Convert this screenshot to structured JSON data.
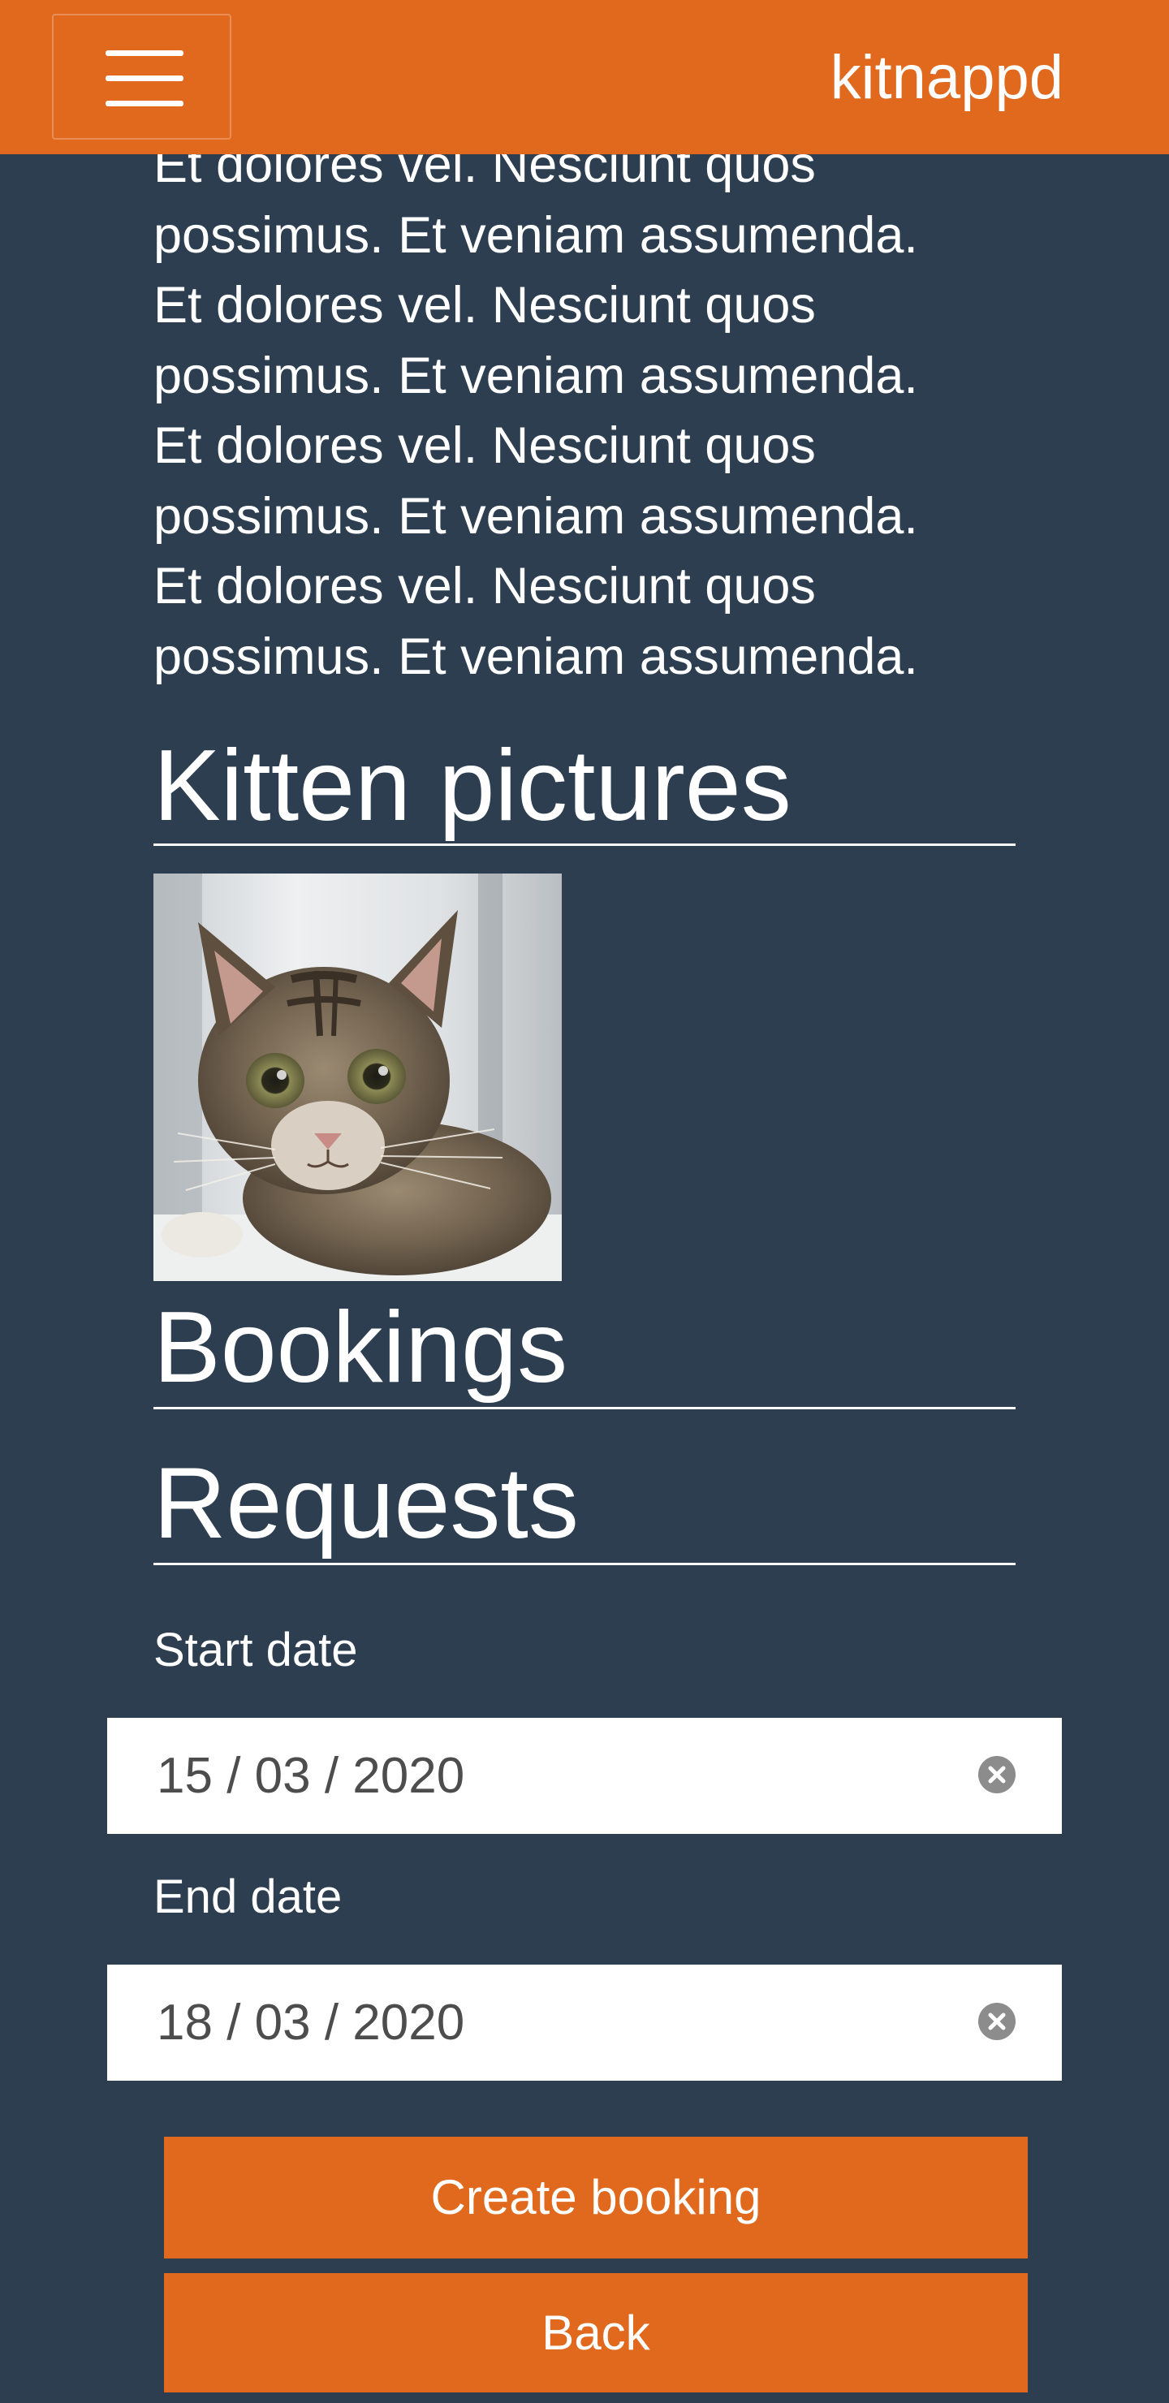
{
  "header": {
    "brand": "kitnappd",
    "menu_icon": "hamburger-menu-icon"
  },
  "intro_lines": [
    "Et dolores vel. Nesciunt quos",
    "possimus. Et veniam assumenda.",
    "Et dolores vel. Nesciunt quos",
    "possimus. Et veniam assumenda.",
    "Et dolores vel. Nesciunt quos",
    "possimus. Et veniam assumenda.",
    "Et dolores vel. Nesciunt quos",
    "possimus. Et veniam assumenda."
  ],
  "sections": {
    "kittens": "Kitten pictures",
    "bookings": "Bookings",
    "requests": "Requests"
  },
  "form": {
    "start_label": "Start date",
    "start_value": "15 / 03 / 2020",
    "end_label": "End date",
    "end_value": "18 / 03 / 2020",
    "clear_icon": "clear-circle-x-icon"
  },
  "buttons": {
    "create": "Create booking",
    "back": "Back"
  },
  "colors": {
    "header": "#e0691e",
    "background": "#2c3e50",
    "button": "#e0691e"
  }
}
